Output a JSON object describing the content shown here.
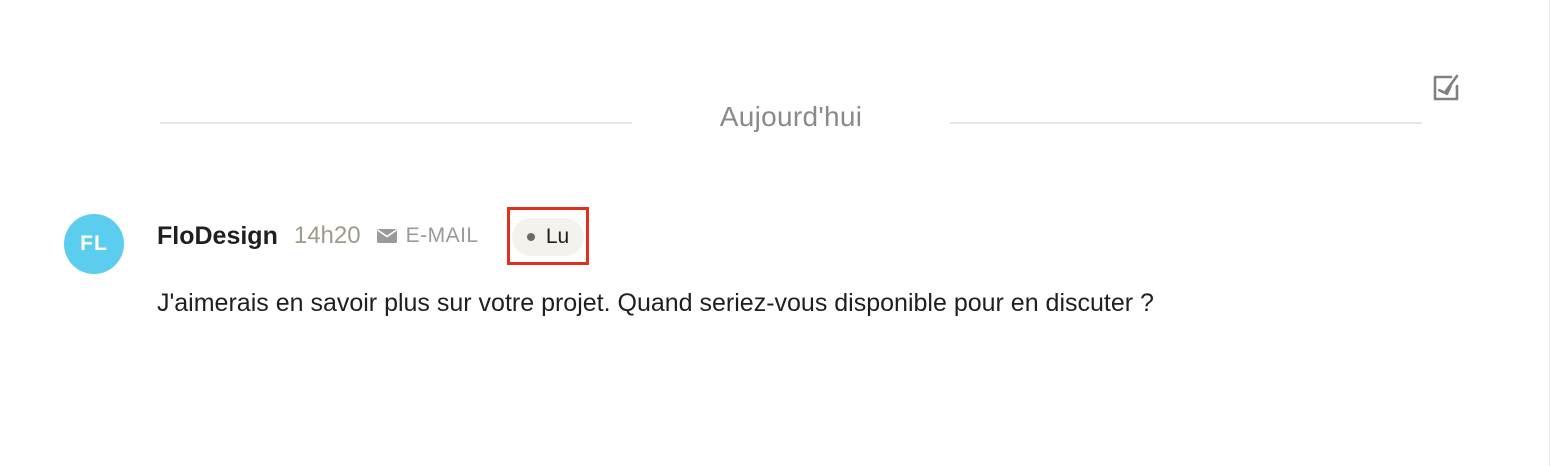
{
  "divider": {
    "label": "Aujourd'hui"
  },
  "toolbar": {
    "icon": "checkbox-arrow-icon"
  },
  "message": {
    "avatar_initials": "FL",
    "avatar_color": "#5bcdee",
    "sender": "FloDesign",
    "time": "14h20",
    "channel_icon": "envelope-icon",
    "channel_label": "E-MAIL",
    "status_label": "Lu",
    "body": "J'aimerais en savoir plus sur votre projet. Quand seriez-vous disponible pour en discuter ?"
  },
  "colors": {
    "highlight": "#e0301e",
    "badge_bg": "#f4f2ec",
    "time": "#a09a8a"
  }
}
